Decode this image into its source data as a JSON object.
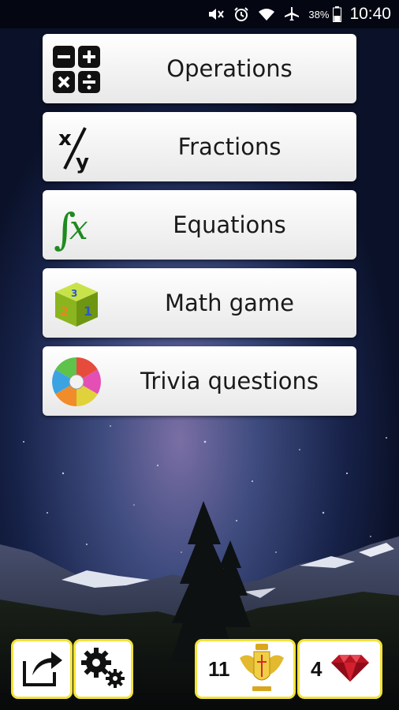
{
  "status_bar": {
    "battery": "38%",
    "time": "10:40",
    "icons": [
      "mute-icon",
      "alarm-icon",
      "wifi-icon",
      "airplane-icon",
      "battery-icon"
    ]
  },
  "menu": [
    {
      "label": "Operations",
      "icon": "operations-icon"
    },
    {
      "label": "Fractions",
      "icon": "fraction-icon"
    },
    {
      "label": "Equations",
      "icon": "integral-icon"
    },
    {
      "label": "Math game",
      "icon": "number-cube-icon"
    },
    {
      "label": "Trivia questions",
      "icon": "color-wheel-icon"
    }
  ],
  "bottom_bar": {
    "share_icon": "share-icon",
    "settings_icon": "settings-gears-icon",
    "badges_count": "11",
    "badges_icon": "coat-of-arms-icon",
    "gems_count": "4",
    "gems_icon": "ruby-gem-icon"
  },
  "colors": {
    "button_border": "#f3e33a",
    "sky": "#0c1530"
  }
}
